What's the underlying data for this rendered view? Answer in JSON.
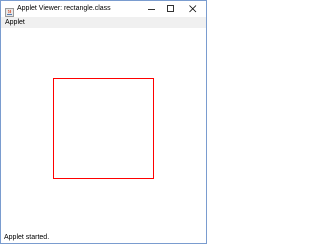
{
  "window": {
    "title": "Applet Viewer: rectangle.class",
    "border_color": "#7a9ccf",
    "icon": "java-icon",
    "controls": {
      "minimize_icon": "minimize-icon",
      "maximize_icon": "maximize-icon",
      "close_icon": "close-icon"
    }
  },
  "menubar": {
    "items": [
      {
        "label": "Applet"
      }
    ]
  },
  "canvas": {
    "shape": "rectangle",
    "stroke_color": "#ff0000",
    "background": "#ffffff"
  },
  "status": {
    "text": "Applet started."
  }
}
